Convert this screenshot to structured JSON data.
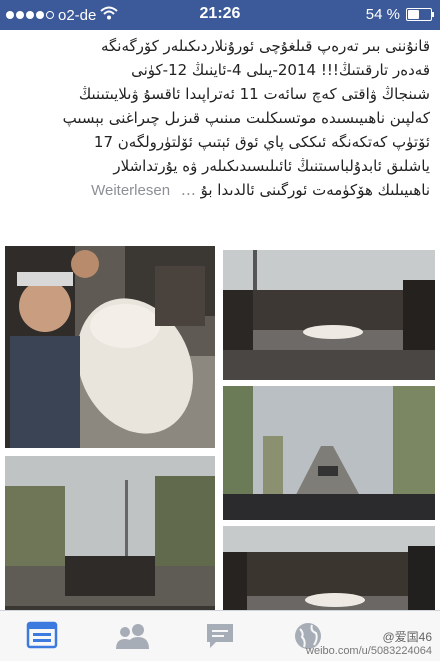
{
  "status_bar": {
    "carrier": "o2-de",
    "time": "21:26",
    "battery": "54 %",
    "battery_level": 0.54,
    "signal_filled": 4,
    "signal_total": 5
  },
  "post": {
    "lines": [
      "قانۇننى بىر تەرەپ قىلغۇچى ئورۇنلاردىكىلەر كۆرگەنگە",
      "قەدەر تارقىتىڭ!!!  2014-يىلى 4-ئاينىڭ 12-كۈنى",
      "شىنجاڭ ۋاقتى كەچ سائەت 11 ئەتراپىدا ئاقسۇ ۋىلايىتىنىڭ",
      "كەلپىن ناھىيىسىدە موتسىكلىت مىنىپ قىزىل چىراغنى بېسىپ",
      "ئۆتۈپ كەتكەنگە ئىككى پاي ئوق ئېتىپ ئۆلتۈرولگەن 17",
      "ياشلىق ئابدۇلباسىتنىڭ ئائىلىسىدىكىلەر ۋە يۇرتداشلار"
    ],
    "last_line": "ناھىيىلىك ھۆكۈمەت ئورگىنى ئالدىدا  بۇ",
    "read_more": "Weiterlesen"
  },
  "tabs": {
    "items": [
      "news-feed-tab",
      "friend-requests-tab",
      "messages-tab",
      "notifications-tab",
      "more-tab"
    ],
    "active_color": "#3c7ae0",
    "inactive_color": "#a7adb7"
  },
  "watermark": {
    "handle": "@爱国46",
    "url": "weibo.com/u/5083224064"
  }
}
